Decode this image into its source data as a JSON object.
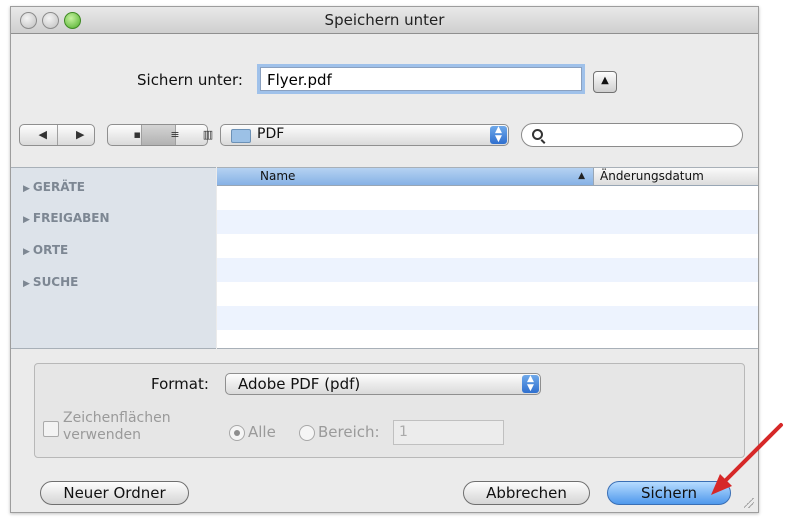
{
  "window": {
    "title": "Speichern unter"
  },
  "save": {
    "label": "Sichern unter:",
    "filename": "Flyer.pdf"
  },
  "toolbar": {
    "location": "PDF",
    "search_value": ""
  },
  "sidebar": {
    "items": [
      {
        "label": "GERÄTE"
      },
      {
        "label": "FREIGABEN"
      },
      {
        "label": "ORTE"
      },
      {
        "label": "SUCHE"
      }
    ]
  },
  "filelist": {
    "columns": [
      "Name",
      "Änderungsdatum"
    ],
    "sort_column": "Name"
  },
  "options": {
    "format_label": "Format:",
    "format_value": "Adobe PDF (pdf)",
    "artboards_label_1": "Zeichenflächen",
    "artboards_label_2": "verwenden",
    "radio_all": "Alle",
    "radio_range": "Bereich:",
    "range_value": "1"
  },
  "buttons": {
    "new_folder": "Neuer Ordner",
    "cancel": "Abbrechen",
    "save": "Sichern"
  },
  "colors": {
    "annotation_arrow": "#d62828",
    "default_button": "#4f98ec"
  }
}
